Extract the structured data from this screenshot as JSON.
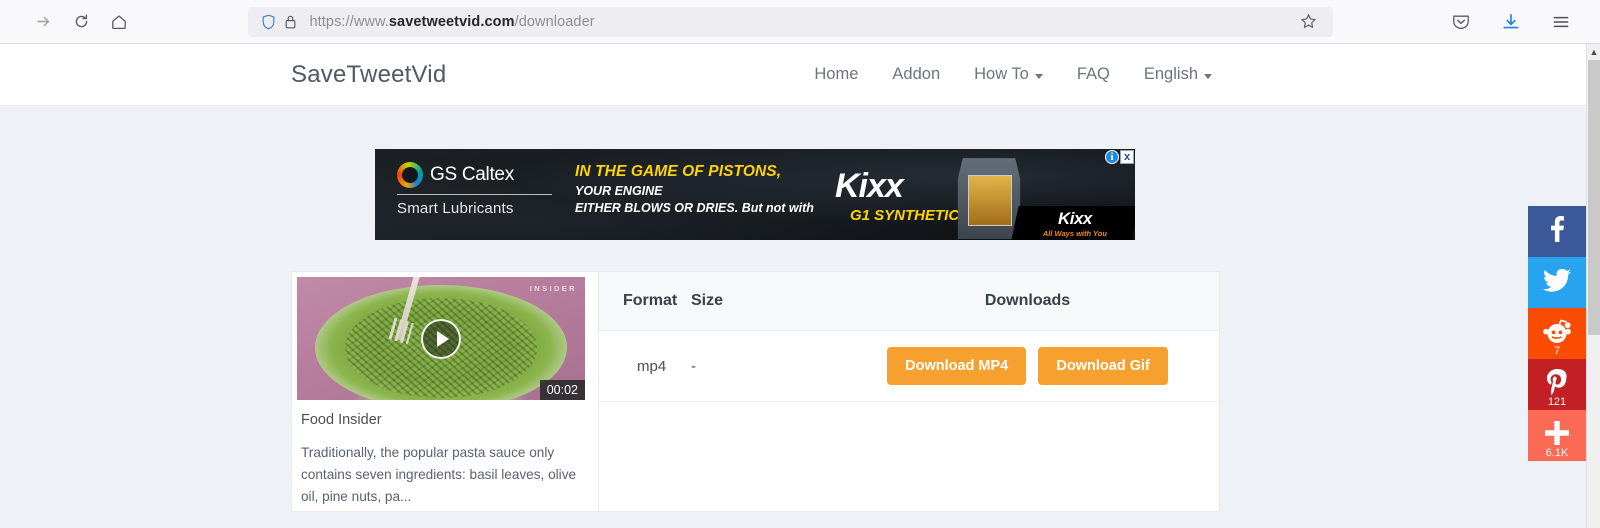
{
  "browser": {
    "forward_tooltip": "Forward",
    "reload_tooltip": "Reload",
    "home_tooltip": "Home",
    "url_display_prefix": "https://www.",
    "url_domain": "savetweetvid.com",
    "url_path": "/downloader",
    "bookmark_tooltip": "Bookmark this page",
    "pocket_tooltip": "Save to Pocket",
    "downloads_tooltip": "Downloads",
    "menu_tooltip": "Open application menu"
  },
  "site": {
    "brand": "SaveTweetVid",
    "nav": [
      {
        "label": "Home",
        "has_caret": false
      },
      {
        "label": "Addon",
        "has_caret": false
      },
      {
        "label": "How To",
        "has_caret": true
      },
      {
        "label": "FAQ",
        "has_caret": false
      },
      {
        "label": "English",
        "has_caret": true
      }
    ]
  },
  "ad": {
    "brand": "GS",
    "brand_rest": "Caltex",
    "tagline": "Smart Lubricants",
    "line1": "IN THE GAME OF PISTONS,",
    "line2": "YOUR ENGINE",
    "line3": "EITHER BLOWS OR DRIES.",
    "line3_em": "But not with",
    "product": "Kixx",
    "product_sub": "G1 SYNTHETIC",
    "corner_brand": "Kixx",
    "corner_slogan": "All Ways with You",
    "adchoices_info": "i",
    "adchoices_close": "x"
  },
  "video": {
    "watermark": "INSIDER",
    "duration": "00:02",
    "play_label": "Play",
    "title": "Food Insider",
    "description": "Traditionally, the popular pasta sauce only contains seven ingredients: basil leaves, olive oil, pine nuts, pa..."
  },
  "table": {
    "headers": {
      "format": "Format",
      "size": "Size",
      "downloads": "Downloads"
    },
    "rows": [
      {
        "format": "mp4",
        "size": "-",
        "buttons": [
          {
            "label": "Download MP4",
            "color": "#f5a02f"
          },
          {
            "label": "Download Gif",
            "color": "#f5a02f"
          }
        ]
      }
    ]
  },
  "social": [
    {
      "name": "facebook",
      "glyph": "f",
      "count": "",
      "color": "#3b5998"
    },
    {
      "name": "twitter",
      "glyph": "ᴠ",
      "count": "",
      "color": "#27a3ef"
    },
    {
      "name": "reddit",
      "glyph": "Ⓡ",
      "count": "7",
      "color": "#fa4c05"
    },
    {
      "name": "pinterest",
      "glyph": "P",
      "count": "121",
      "color": "#c32026"
    },
    {
      "name": "addthis",
      "glyph": "+",
      "count": "6.1K",
      "color": "#fb6a54"
    }
  ],
  "scrollbar": {
    "up_arrow": "▲",
    "down_arrow": "▼"
  }
}
